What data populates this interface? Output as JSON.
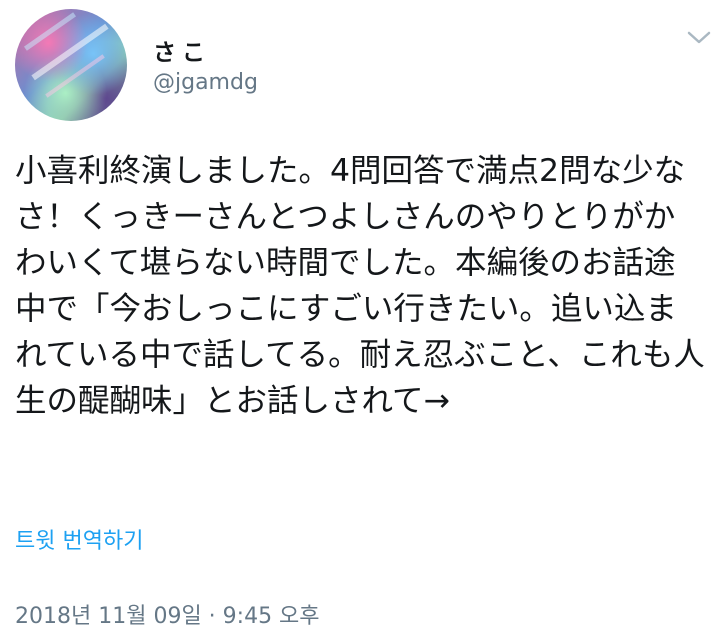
{
  "user": {
    "display_name": "さこ",
    "handle": "@jgamdg"
  },
  "tweet": {
    "text": "小喜利終演しました。4問回答で満点2問な少なさ！くっきーさんとつよしさんのやりとりがかわいくて堪らない時間でした。本編後のお話途中で「今おしっこにすごい行きたい。追い込まれている中で話してる。耐え忍ぶこと、これも人生の醍醐味」とお話しされて→",
    "translate_label": "트윗 번역하기",
    "timestamp": "2018년 11월 09일 · 9:45 오후"
  },
  "icons": {
    "avatar": "user-avatar",
    "menu": "chevron-down-icon"
  },
  "colors": {
    "link": "#1da1f2",
    "secondary_text": "#657786",
    "primary_text": "#14171a"
  }
}
